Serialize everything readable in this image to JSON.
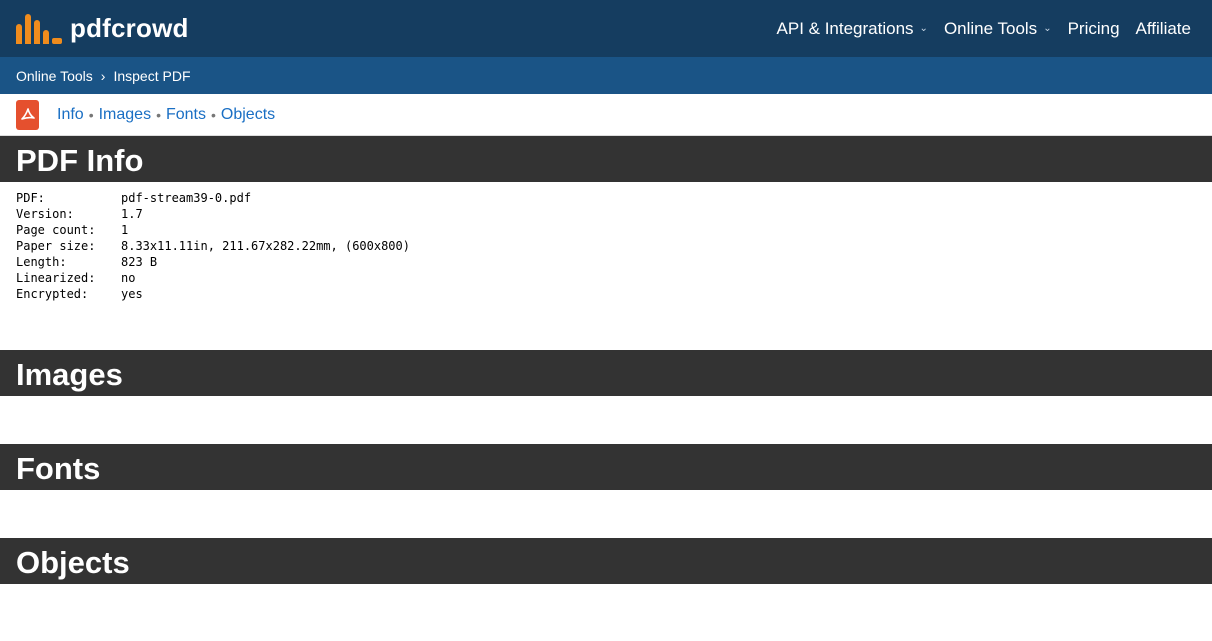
{
  "brand": {
    "name": "pdfcrowd"
  },
  "nav": {
    "items": [
      {
        "label": "API & Integrations",
        "has_dropdown": true
      },
      {
        "label": "Online Tools",
        "has_dropdown": true
      },
      {
        "label": "Pricing",
        "has_dropdown": false
      },
      {
        "label": "Affiliate",
        "has_dropdown": false
      }
    ]
  },
  "breadcrumb": {
    "parent": "Online Tools",
    "separator": "›",
    "current": "Inspect PDF"
  },
  "toolbar": {
    "icon": "pdf-file-icon",
    "links": [
      "Info",
      "Images",
      "Fonts",
      "Objects"
    ],
    "separator": "•"
  },
  "sections": {
    "info_title": "PDF Info",
    "images_title": "Images",
    "fonts_title": "Fonts",
    "objects_title": "Objects"
  },
  "pdf_info": [
    {
      "key": "PDF:",
      "value": "pdf-stream39-0.pdf"
    },
    {
      "key": "Version:",
      "value": "1.7"
    },
    {
      "key": "Page count:",
      "value": "1"
    },
    {
      "key": "Paper size:",
      "value": "8.33x11.11in, 211.67x282.22mm, (600x800)"
    },
    {
      "key": "Length:",
      "value": "823 B"
    },
    {
      "key": "Linearized:",
      "value": "no"
    },
    {
      "key": "Encrypted:",
      "value": "yes"
    }
  ],
  "colors": {
    "nav_bg": "#153d60",
    "breadcrumb_bg": "#1a5486",
    "brand_accent": "#f08c1d",
    "section_header_bg": "#333333",
    "link": "#1a6fc4",
    "pdf_icon": "#e5502e"
  }
}
